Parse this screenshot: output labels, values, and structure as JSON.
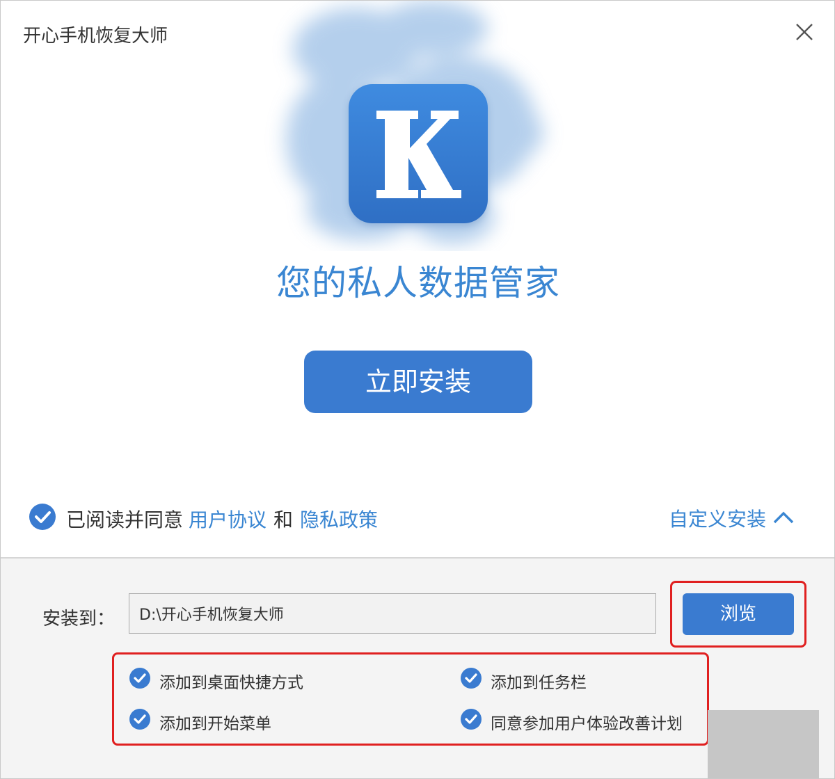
{
  "window": {
    "title": "开心手机恢复大师",
    "close_icon": "close-icon"
  },
  "hero": {
    "logo_letter": "K",
    "slogan": "您的私人数据管家",
    "install_label": "立即安装"
  },
  "agreement": {
    "checked": true,
    "prefix": "已阅读并同意",
    "user_agreement": "用户协议",
    "and": "和",
    "privacy_policy": "隐私政策"
  },
  "custom_install": {
    "label": "自定义安装",
    "icon": "chevron-up-icon"
  },
  "install_path": {
    "label": "安装到：",
    "value": "D:\\开心手机恢复大师",
    "browse_label": "浏览"
  },
  "options": [
    {
      "label": "添加到桌面快捷方式",
      "checked": true
    },
    {
      "label": "添加到任务栏",
      "checked": true
    },
    {
      "label": "添加到开始菜单",
      "checked": true
    },
    {
      "label": "同意参加用户体验改善计划",
      "checked": true
    }
  ],
  "colors": {
    "accent": "#3a7bd0",
    "link": "#3a86d2",
    "highlight_box": "#e02020"
  }
}
